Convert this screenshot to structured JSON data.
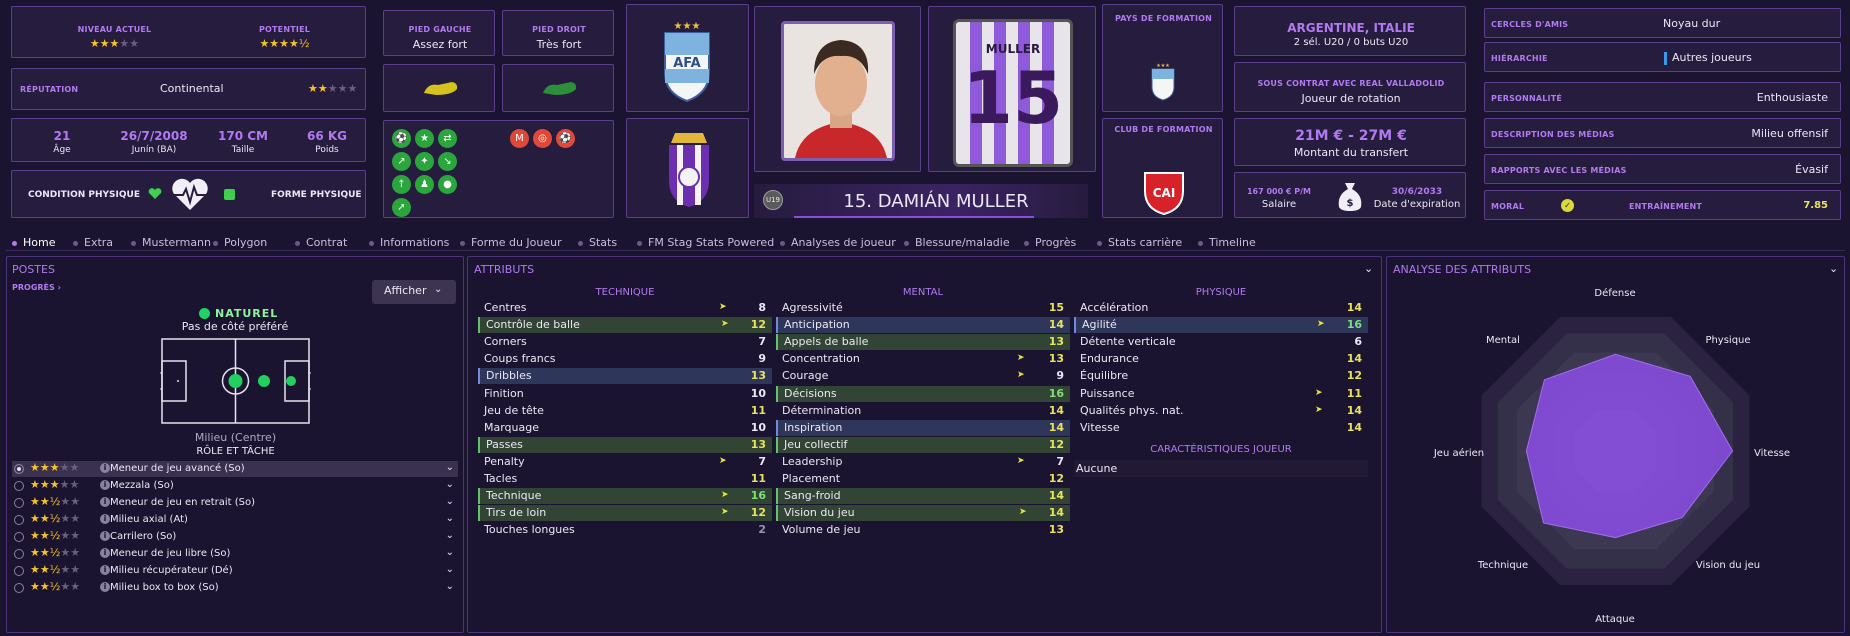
{
  "top": {
    "niveau_actuel_label": "NIVEAU ACTUEL",
    "niveau_actuel_stars": "★★★",
    "niveau_actuel_stars_off": "★★",
    "potentiel_label": "POTENTIEL",
    "potentiel_stars": "★★★★",
    "potentiel_half": "½",
    "reputation_label": "RÉPUTATION",
    "reputation_value": "Continental",
    "reputation_stars": "★★",
    "reputation_stars_off": "★★★",
    "age_value": "21",
    "age_label": "Âge",
    "dob_value": "26/7/2008",
    "dob_label": "Junín (BA)",
    "height_value": "170 CM",
    "height_label": "Taille",
    "weight_value": "66 KG",
    "weight_label": "Poids",
    "condition_label": "CONDITION PHYSIQUE",
    "forme_label": "FORME PHYSIQUE",
    "pied_gauche_label": "PIED GAUCHE",
    "pied_gauche_value": "Assez fort",
    "pied_droit_label": "PIED DROIT",
    "pied_droit_value": "Très fort",
    "player_name": "15. DAMIÁN MULLER",
    "u19_badge": "U19",
    "shirt_name": "MULLER",
    "shirt_number": "15",
    "pays_formation_label": "PAYS DE FORMATION",
    "club_formation_label": "CLUB DE FORMATION",
    "nationality": "ARGENTINE, ITALIE",
    "selections": "2 sél. U20 / 0 buts U20",
    "contract_label": "SOUS CONTRAT AVEC REAL VALLADOLID",
    "contract_role": "Joueur de rotation",
    "transfer_value": "21M € - 27M €",
    "transfer_label": "Montant du transfert",
    "salary_value": "167 000 € P/M",
    "salary_label": "Salaire",
    "expiry_value": "30/6/2033",
    "expiry_label": "Date d'expiration",
    "info_rows": [
      {
        "label": "CERCLES D'AMIS",
        "value": "Noyau dur"
      },
      {
        "label": "HIÉRARCHIE",
        "value": "Autres joueurs"
      },
      {
        "label": "PERSONNALITÉ",
        "value": "Enthousiaste"
      },
      {
        "label": "DESCRIPTION DES MÉDIAS",
        "value": "Milieu offensif"
      },
      {
        "label": "RAPPORTS AVEC LES MÉDIAS",
        "value": "Évasif"
      }
    ],
    "moral_label": "MORAL",
    "entrainement_label": "ENTRAÎNEMENT",
    "entrainement_value": "7.85"
  },
  "tabs": [
    "Home",
    "Extra",
    "Mustermann",
    "Polygon",
    "Contrat",
    "Informations",
    "Forme du Joueur",
    "Stats",
    "FM Stag Stats Powered",
    "Analyses de joueur",
    "Blessure/maladie",
    "Progrès",
    "Stats carrière",
    "Timeline"
  ],
  "postes": {
    "title": "POSTES",
    "progres": "PROGRÈS ›",
    "afficher": "Afficher",
    "naturel": "NATUREL",
    "pas_de_cote": "Pas de côté préféré",
    "position_name": "Milieu (Centre)",
    "role_heading": "RÔLE ET TÂCHE",
    "roles": [
      {
        "stars": "★★★",
        "off": "★★",
        "name": "Meneur de jeu avancé (So)"
      },
      {
        "stars": "★★★",
        "off": "★★",
        "name": "Mezzala (So)"
      },
      {
        "stars": "★★½",
        "off": "★★",
        "name": "Meneur de jeu en retrait (So)"
      },
      {
        "stars": "★★½",
        "off": "★★",
        "name": "Milieu axial (At)"
      },
      {
        "stars": "★★½",
        "off": "★★",
        "name": "Carrilero (So)"
      },
      {
        "stars": "★★½",
        "off": "★★",
        "name": "Meneur de jeu libre (So)"
      },
      {
        "stars": "★★½",
        "off": "★★",
        "name": "Milieu récupérateur (Dé)"
      },
      {
        "stars": "★★½",
        "off": "★★",
        "name": "Milieu box to box (So)"
      }
    ]
  },
  "attributs": {
    "title": "ATTRIBUTS",
    "technique_heading": "TECHNIQUE",
    "mental_heading": "MENTAL",
    "physique_heading": "PHYSIQUE",
    "caracteristiques_heading": "CARACTÉRISTIQUES JOUEUR",
    "caracteristiques_value": "Aucune",
    "technique": [
      {
        "name": "Centres",
        "value": "8"
      },
      {
        "name": "Contrôle de balle",
        "value": "12"
      },
      {
        "name": "Corners",
        "value": "7"
      },
      {
        "name": "Coups francs",
        "value": "9"
      },
      {
        "name": "Dribbles",
        "value": "13"
      },
      {
        "name": "Finition",
        "value": "10"
      },
      {
        "name": "Jeu de tête",
        "value": "11"
      },
      {
        "name": "Marquage",
        "value": "10"
      },
      {
        "name": "Passes",
        "value": "13"
      },
      {
        "name": "Penalty",
        "value": "7"
      },
      {
        "name": "Tacles",
        "value": "11"
      },
      {
        "name": "Technique",
        "value": "16"
      },
      {
        "name": "Tirs de loin",
        "value": "12"
      },
      {
        "name": "Touches longues",
        "value": "2"
      }
    ],
    "mental": [
      {
        "name": "Agressivité",
        "value": "15"
      },
      {
        "name": "Anticipation",
        "value": "14"
      },
      {
        "name": "Appels de balle",
        "value": "13"
      },
      {
        "name": "Concentration",
        "value": "13"
      },
      {
        "name": "Courage",
        "value": "9"
      },
      {
        "name": "Décisions",
        "value": "16"
      },
      {
        "name": "Détermination",
        "value": "14"
      },
      {
        "name": "Inspiration",
        "value": "14"
      },
      {
        "name": "Jeu collectif",
        "value": "12"
      },
      {
        "name": "Leadership",
        "value": "7"
      },
      {
        "name": "Placement",
        "value": "12"
      },
      {
        "name": "Sang-froid",
        "value": "14"
      },
      {
        "name": "Vision du jeu",
        "value": "14"
      },
      {
        "name": "Volume de jeu",
        "value": "13"
      }
    ],
    "physique": [
      {
        "name": "Accélération",
        "value": "14"
      },
      {
        "name": "Agilité",
        "value": "16"
      },
      {
        "name": "Détente verticale",
        "value": "6"
      },
      {
        "name": "Endurance",
        "value": "14"
      },
      {
        "name": "Équilibre",
        "value": "12"
      },
      {
        "name": "Puissance",
        "value": "11"
      },
      {
        "name": "Qualités phys. nat.",
        "value": "14"
      },
      {
        "name": "Vitesse",
        "value": "14"
      }
    ]
  },
  "analyse": {
    "title": "ANALYSE DES ATTRIBUTS",
    "labels": [
      "Défense",
      "Physique",
      "Vitesse",
      "Vision du jeu",
      "Attaque",
      "Technique",
      "Jeu aérien",
      "Mental"
    ]
  }
}
